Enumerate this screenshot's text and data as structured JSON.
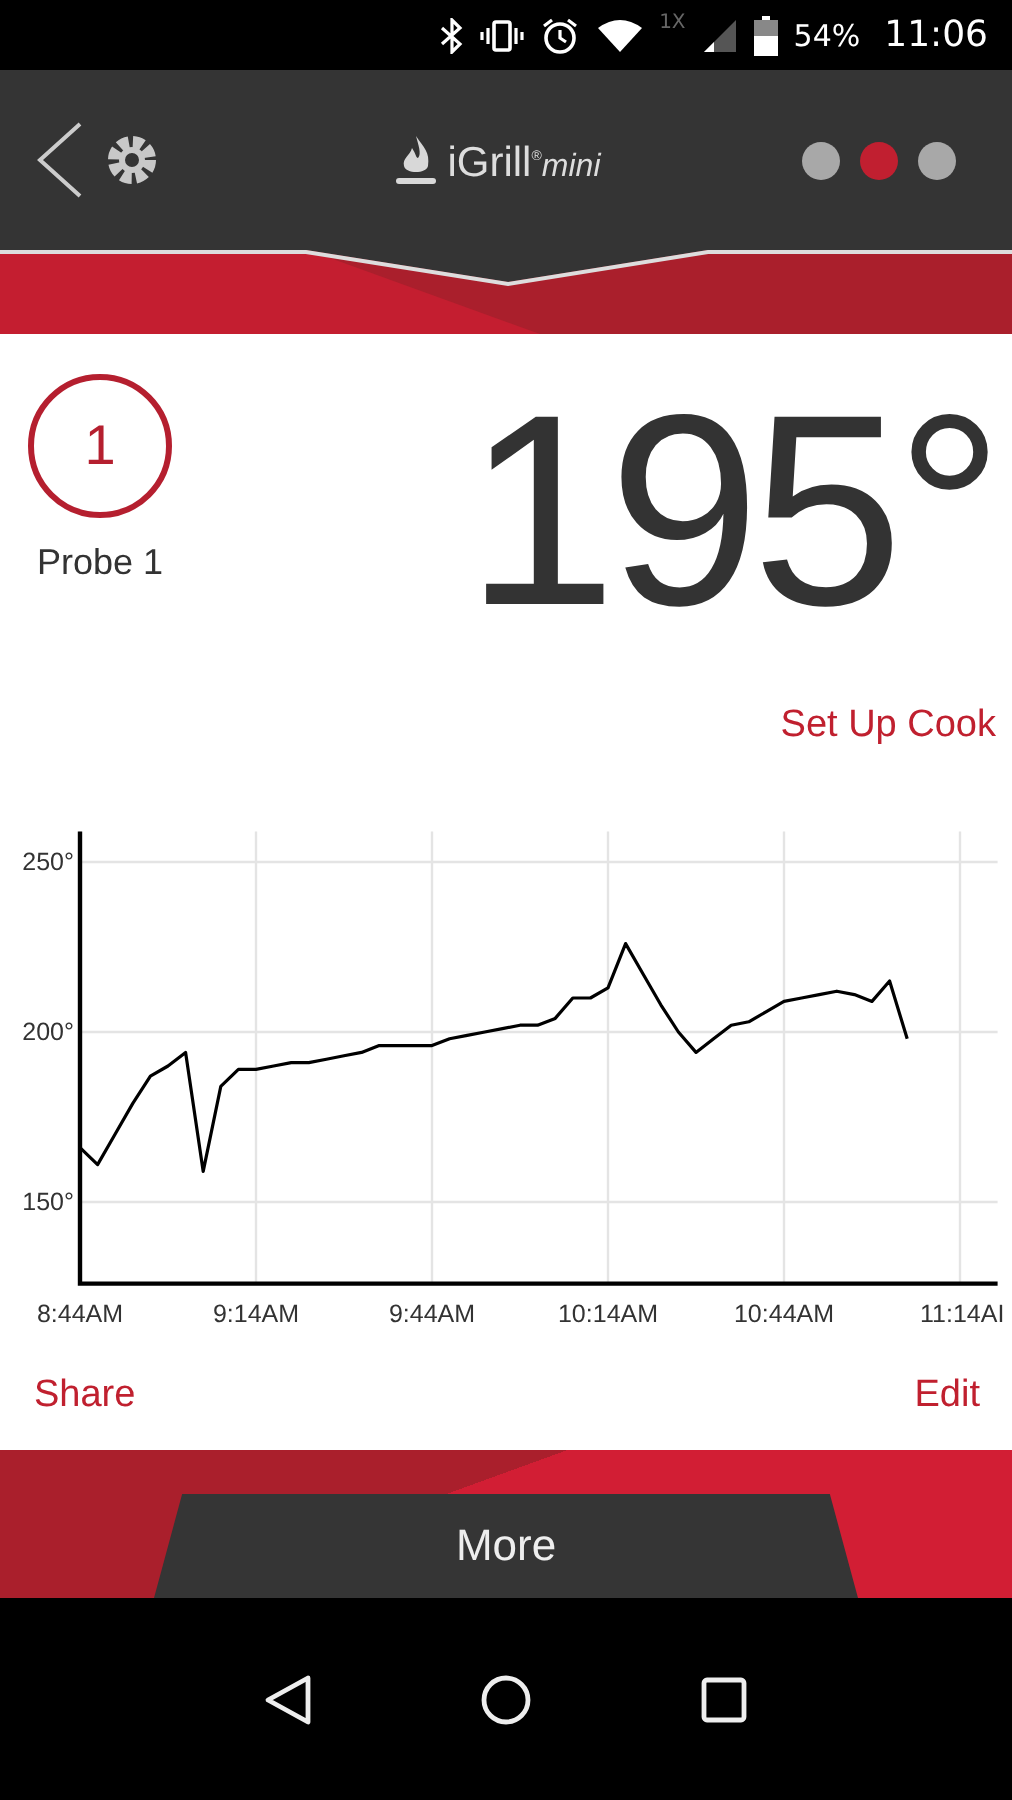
{
  "status_bar": {
    "network": "1X",
    "battery": "54%",
    "time": "11:06"
  },
  "header": {
    "logo": {
      "name": "iGrill",
      "mark": "®",
      "suffix": "mini"
    },
    "page_dots": [
      {
        "selected": false
      },
      {
        "selected": true
      },
      {
        "selected": false
      }
    ]
  },
  "probe": {
    "number": "1",
    "label": "Probe 1",
    "temperature": "195°"
  },
  "set_up_cook": "Set Up Cook",
  "chart": {
    "chart_data": {
      "type": "line",
      "categories": [
        "8:44AM",
        null,
        null,
        null,
        null,
        null,
        null,
        null,
        null,
        null,
        "9:14AM",
        null,
        null,
        null,
        null,
        null,
        null,
        null,
        null,
        null,
        "9:44AM",
        null,
        null,
        null,
        null,
        null,
        null,
        null,
        null,
        null,
        "10:14AM",
        null,
        null,
        null,
        null,
        null,
        null,
        null,
        null,
        null,
        "10:44AM",
        null,
        null,
        null,
        null,
        null,
        null,
        null,
        null,
        null,
        "11:14AI",
        null
      ],
      "series": [
        {
          "color": "#000000",
          "values": [
            166,
            161,
            170,
            179,
            187,
            190,
            194,
            159,
            184,
            189,
            189,
            190,
            191,
            191,
            192,
            193,
            194,
            196,
            196,
            196,
            196,
            198,
            199,
            200,
            201,
            202,
            202,
            204,
            210,
            210,
            213,
            226,
            217,
            208,
            200,
            194,
            198,
            202,
            203,
            206,
            209,
            210,
            211,
            212,
            211,
            209,
            215,
            198,
            null,
            null,
            null,
            null
          ]
        }
      ],
      "ylim": [
        126,
        259
      ],
      "grid": true,
      "yticks": [
        {
          "value": 150,
          "label": "150°"
        },
        {
          "value": 200,
          "label": "200°"
        },
        {
          "value": 250,
          "label": "250°"
        }
      ]
    }
  },
  "actions": [
    "Share",
    "Edit"
  ],
  "more_button": "More"
}
